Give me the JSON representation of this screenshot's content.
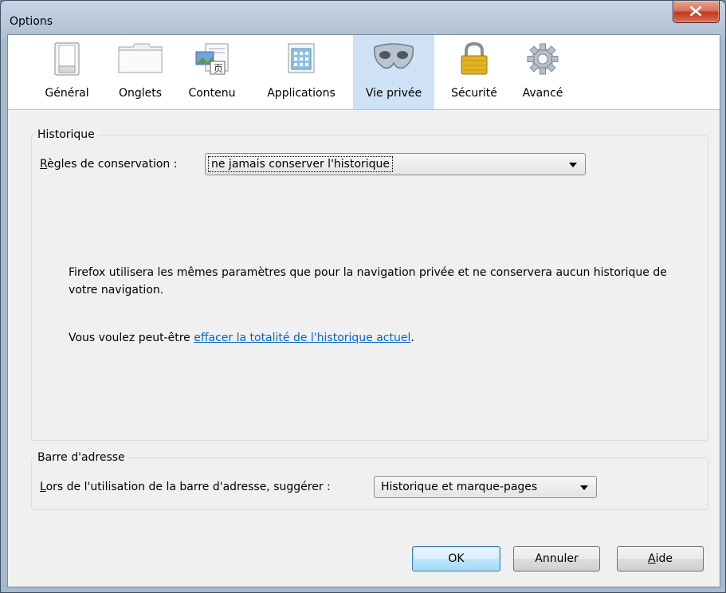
{
  "window": {
    "title": "Options",
    "close_label": "X"
  },
  "toolbar": {
    "panes": [
      {
        "label": "Général",
        "icon": "switch-icon"
      },
      {
        "label": "Onglets",
        "icon": "tabs-icon"
      },
      {
        "label": "Contenu",
        "icon": "content-icon"
      },
      {
        "label": "Applications",
        "icon": "applications-icon"
      },
      {
        "label": "Vie privée",
        "icon": "mask-icon",
        "selected": true
      },
      {
        "label": "Sécurité",
        "icon": "padlock-icon"
      },
      {
        "label": "Avancé",
        "icon": "gear-icon"
      }
    ]
  },
  "history": {
    "group_title": "Historique",
    "rules_label_first": "R",
    "rules_label_rest": "ègles de conservation :",
    "rules_value": "ne jamais conserver l'historique",
    "description": "Firefox utilisera les mêmes paramètres que pour la navigation privée et ne conservera aucun historique de votre navigation.",
    "clear_prefix": "Vous voulez peut-être ",
    "clear_link": "effacer la totalité de l'historique actuel",
    "clear_suffix": "."
  },
  "addressbar": {
    "group_title": "Barre d'adresse",
    "suggest_label_first": "L",
    "suggest_label_rest": "ors de l'utilisation de la barre d'adresse, suggérer :",
    "suggest_value": "Historique et marque-pages"
  },
  "buttons": {
    "ok": "OK",
    "cancel": "Annuler",
    "help_first": "A",
    "help_rest": "ide"
  }
}
